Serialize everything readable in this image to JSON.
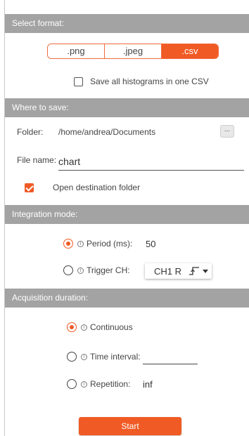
{
  "colors": {
    "accent": "#f05a24",
    "header_bg": "#a3a3a3"
  },
  "format": {
    "header": "Select format:",
    "options": [
      ".png",
      ".jpeg",
      ".csv"
    ],
    "selected": ".csv",
    "save_all_csv_label": "Save all histograms in one CSV",
    "save_all_csv_checked": false
  },
  "save": {
    "header": "Where to save:",
    "folder_label": "Folder:",
    "folder_value": "/home/andrea/Documents",
    "browse_label": "...",
    "filename_label": "File name:",
    "filename_value": "chart",
    "open_destination_label": "Open destination folder",
    "open_destination_checked": true
  },
  "integration": {
    "header": "Integration mode:",
    "period_label": "Period (ms):",
    "period_value": "50",
    "period_selected": true,
    "trigger_label": "Trigger CH:",
    "trigger_value": "CH1 R",
    "trigger_edge_icon": "rising-edge-icon",
    "trigger_selected": false
  },
  "acquisition": {
    "header": "Acquisition duration:",
    "continuous_label": "Continuous",
    "continuous_selected": true,
    "interval_label": "Time interval:",
    "interval_value": "",
    "repetition_label": "Repetition:",
    "repetition_value": "inf"
  },
  "info_icon_glyph": "i",
  "start_label": "Start"
}
